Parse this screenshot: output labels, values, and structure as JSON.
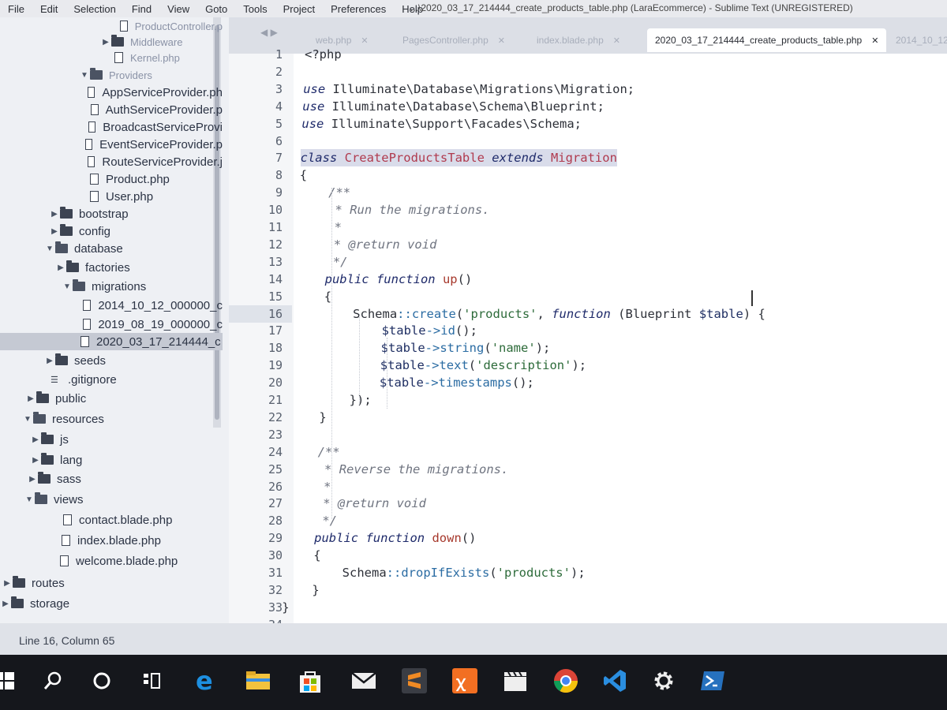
{
  "window": {
    "title": "...\\2020_03_17_214444_create_products_table.php (LaraEcommerce) - Sublime Text (UNREGISTERED)"
  },
  "menu": [
    "File",
    "Edit",
    "Selection",
    "Find",
    "View",
    "Goto",
    "Tools",
    "Project",
    "Preferences",
    "Help"
  ],
  "sidebar": {
    "items": [
      {
        "label": "ProductController.p",
        "type": "file",
        "faded": true
      },
      {
        "label": "Middleware",
        "type": "folder",
        "faded": true
      },
      {
        "label": "Kernel.php",
        "type": "file",
        "faded": true
      },
      {
        "label": "Providers",
        "type": "folder-open",
        "faded": true
      },
      {
        "label": "AppServiceProvider.ph",
        "type": "file"
      },
      {
        "label": "AuthServiceProvider.p",
        "type": "file"
      },
      {
        "label": "BroadcastServiceProvi",
        "type": "file"
      },
      {
        "label": "EventServiceProvider.p",
        "type": "file"
      },
      {
        "label": "RouteServiceProvider.j",
        "type": "file"
      },
      {
        "label": "Product.php",
        "type": "file"
      },
      {
        "label": "User.php",
        "type": "file"
      },
      {
        "label": "bootstrap",
        "type": "folder"
      },
      {
        "label": "config",
        "type": "folder"
      },
      {
        "label": "database",
        "type": "folder-open"
      },
      {
        "label": "factories",
        "type": "folder"
      },
      {
        "label": "migrations",
        "type": "folder-open"
      },
      {
        "label": "2014_10_12_000000_c",
        "type": "file"
      },
      {
        "label": "2019_08_19_000000_c",
        "type": "file"
      },
      {
        "label": "2020_03_17_214444_c",
        "type": "file",
        "selected": true
      },
      {
        "label": "seeds",
        "type": "folder"
      },
      {
        "label": ".gitignore",
        "type": "gitignore"
      },
      {
        "label": "public",
        "type": "folder"
      },
      {
        "label": "resources",
        "type": "folder-open"
      },
      {
        "label": "js",
        "type": "folder"
      },
      {
        "label": "lang",
        "type": "folder"
      },
      {
        "label": "sass",
        "type": "folder"
      },
      {
        "label": "views",
        "type": "folder-open"
      },
      {
        "label": "contact.blade.php",
        "type": "file"
      },
      {
        "label": "index.blade.php",
        "type": "file"
      },
      {
        "label": "welcome.blade.php",
        "type": "file"
      },
      {
        "label": "routes",
        "type": "folder"
      },
      {
        "label": "storage",
        "type": "folder"
      }
    ]
  },
  "tabs": [
    {
      "label": "web.php",
      "active": false
    },
    {
      "label": "PagesController.php",
      "active": false
    },
    {
      "label": "index.blade.php",
      "active": false
    },
    {
      "label": "2020_03_17_214444_create_products_table.php",
      "active": true
    },
    {
      "label": "2014_10_12_",
      "active": false
    }
  ],
  "tab_nav": "◀ ▶",
  "tab_close": "✕",
  "editor": {
    "current_line": 16,
    "lines": [
      "<?php",
      "",
      "use Illuminate\\Database\\Migrations\\Migration;",
      "use Illuminate\\Database\\Schema\\Blueprint;",
      "use Illuminate\\Support\\Facades\\Schema;",
      "",
      "class CreateProductsTable extends Migration",
      "{",
      "    /**",
      "     * Run the migrations.",
      "     *",
      "     * @return void",
      "     */",
      "    public function up()",
      "    {",
      "        Schema::create('products', function (Blueprint $table) {",
      "            $table->id();",
      "            $table->string('name');",
      "            $table->text('description');",
      "            $table->timestamps();",
      "        });",
      "    }",
      "",
      "    /**",
      "     * Reverse the migrations.",
      "     *",
      "     * @return void",
      "     */",
      "    public function down()",
      "    {",
      "        Schema::dropIfExists('products');",
      "    }",
      "}",
      ""
    ]
  },
  "status": {
    "position": "Line 16, Column 65"
  },
  "taskbar": {
    "icons": [
      "windows-start-icon",
      "search-icon",
      "cortana-icon",
      "task-view-icon",
      "edge-icon",
      "file-explorer-icon",
      "store-icon",
      "mail-icon",
      "sublime-text-icon",
      "xampp-icon",
      "video-editor-icon",
      "chrome-icon",
      "vscode-icon",
      "settings-icon",
      "powershell-icon"
    ]
  },
  "colors": {
    "keyword": "#1e2a6a",
    "class_name": "#b03a4e",
    "string": "#2d6b3a",
    "comment": "#6f7480",
    "taskbar": "#15171c",
    "accent_sublime": "#f08a24"
  }
}
